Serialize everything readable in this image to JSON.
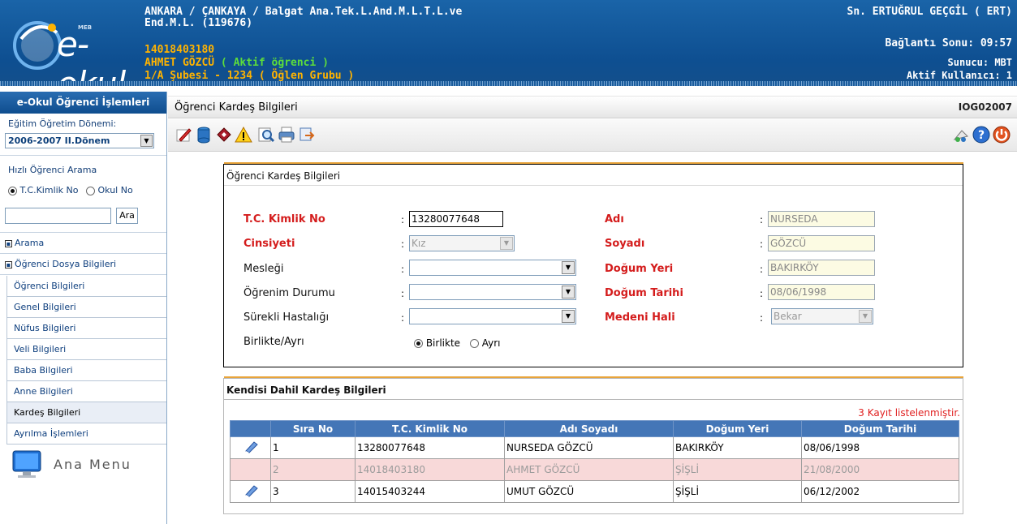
{
  "header": {
    "logo_meb": "MEB",
    "logo_text": "e-okul",
    "school_line1": "ANKARA / ÇANKAYA / Balgat Ana.Tek.L.And.M.L.T.L.ve",
    "school_line2": "End.M.L. (119676)",
    "student_no": "14018403180",
    "student_name": "AHMET GÖZCÜ",
    "student_status": "( Aktif öğrenci )",
    "student_class": "1/A Şubesi - 1234  ( Öğlen Grubu )",
    "user": "Sn. ERTUĞRUL GEÇGİL ( ERT)",
    "connection": "Bağlantı Sonu: 09:57",
    "server": "Sunucu: MBT",
    "active_users": "Aktif Kullanıcı: 1"
  },
  "sidebar": {
    "title": "e-Okul Öğrenci İşlemleri",
    "term_label": "Eğitim Öğretim Dönemi:",
    "term_value": "2006-2007 II.Dönem",
    "quick_search_label": "Hızlı Öğrenci Arama",
    "radio_tc": "T.C.Kimlik No",
    "radio_okul": "Okul No",
    "search_value": "",
    "search_button": "Ara",
    "group_arama": "Arama",
    "group_dosya": "Öğrenci Dosya Bilgileri",
    "items": [
      {
        "label": "Öğrenci Bilgileri"
      },
      {
        "label": "Genel Bilgileri"
      },
      {
        "label": "Nüfus Bilgileri"
      },
      {
        "label": "Veli Bilgileri"
      },
      {
        "label": "Baba Bilgileri"
      },
      {
        "label": "Anne Bilgileri"
      },
      {
        "label": "Kardeş Bilgileri"
      },
      {
        "label": "Ayrılma İşlemleri"
      }
    ],
    "main_menu": "Ana Menu"
  },
  "page": {
    "title": "Öğrenci Kardeş Bilgileri",
    "code": "IOG02007"
  },
  "form": {
    "title": "Öğrenci Kardeş Bilgileri",
    "tc_label": "T.C. Kimlik No",
    "tc_value": "13280077648",
    "gender_label": "Cinsiyeti",
    "gender_value": "Kız",
    "job_label": "Mesleği",
    "job_value": "",
    "edu_label": "Öğrenim Durumu",
    "edu_value": "",
    "illness_label": "Sürekli Hastalığı",
    "illness_value": "",
    "together_label": "Birlikte/Ayrı",
    "together_opt1": "Birlikte",
    "together_opt2": "Ayrı",
    "name_label": "Adı",
    "name_value": "NURSEDA",
    "surname_label": "Soyadı",
    "surname_value": "GÖZCÜ",
    "birthplace_label": "Doğum Yeri",
    "birthplace_value": "BAKIRKÖY",
    "birthdate_label": "Doğum Tarihi",
    "birthdate_value": "08/06/1998",
    "marital_label": "Medeni Hali",
    "marital_value": "Bekar",
    "colon": ":"
  },
  "siblings": {
    "title": "Kendisi Dahil Kardeş Bilgileri",
    "status": "3 Kayıt listelenmiştir.",
    "headers": [
      "Sıra No",
      "T.C. Kimlik No",
      "Adı Soyadı",
      "Doğum Yeri",
      "Doğum Tarihi"
    ],
    "rows": [
      {
        "no": "1",
        "tc": "13280077648",
        "name": "NURSEDA GÖZCÜ",
        "place": "BAKIRKÖY",
        "date": "08/06/1998",
        "editable": true
      },
      {
        "no": "2",
        "tc": "14018403180",
        "name": "AHMET GÖZCÜ",
        "place": "ŞİŞLİ",
        "date": "21/08/2000",
        "editable": false
      },
      {
        "no": "3",
        "tc": "14015403244",
        "name": "UMUT GÖZCÜ",
        "place": "ŞİŞLİ",
        "date": "06/12/2002",
        "editable": true
      }
    ]
  },
  "colors": {
    "header_blue": "#0e4f91",
    "accent_orange": "#ffb300",
    "status_green": "#5ddd3b",
    "label_red": "#d41c1c",
    "table_header": "#4476b7",
    "row_highlight": "#f8d9d9"
  },
  "toolbar_icons": [
    "edit-icon",
    "database-icon",
    "eraser-icon",
    "warning-icon",
    "preview-icon",
    "print-icon",
    "export-icon",
    "connection-icon",
    "help-icon",
    "power-icon"
  ]
}
